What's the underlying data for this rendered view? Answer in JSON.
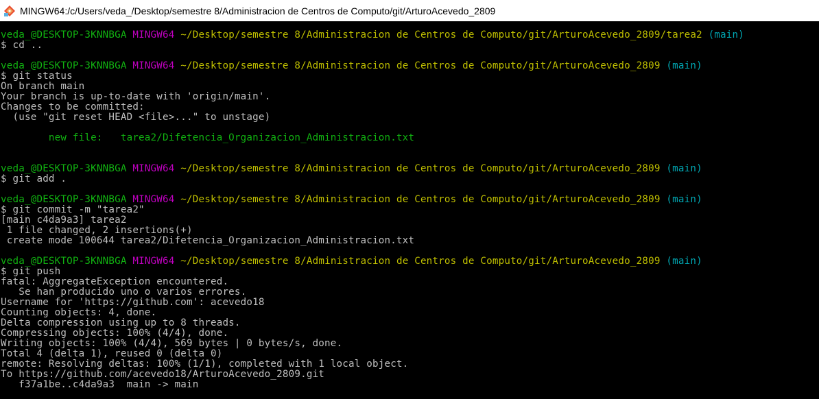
{
  "window": {
    "title": "MINGW64:/c/Users/veda_/Desktop/semestre 8/Administracion de Centros de Computo/git/ArturoAcevedo_2809",
    "icon": "git-bash-icon"
  },
  "colors": {
    "background": "#000000",
    "text": "#c0c0c0",
    "user_host": "#11b311",
    "shell": "#bf00bf",
    "path": "#bfbf00",
    "branch": "#00a6b2",
    "staged_file": "#11b311"
  },
  "lines": [
    {
      "segments": [
        {
          "text": "veda_@DESKTOP-3KNNBGA",
          "color": "green"
        },
        {
          "text": " ",
          "color": "gray"
        },
        {
          "text": "MINGW64",
          "color": "magenta"
        },
        {
          "text": " ",
          "color": "gray"
        },
        {
          "text": "~/Desktop/semestre 8/Administracion de Centros de Computo/git/ArturoAcevedo_2809/tarea2",
          "color": "yellow"
        },
        {
          "text": " ",
          "color": "gray"
        },
        {
          "text": "(main)",
          "color": "cyan"
        }
      ]
    },
    {
      "segments": [
        {
          "text": "$ cd ..",
          "color": "gray"
        }
      ]
    },
    {
      "segments": []
    },
    {
      "segments": [
        {
          "text": "veda_@DESKTOP-3KNNBGA",
          "color": "green"
        },
        {
          "text": " ",
          "color": "gray"
        },
        {
          "text": "MINGW64",
          "color": "magenta"
        },
        {
          "text": " ",
          "color": "gray"
        },
        {
          "text": "~/Desktop/semestre 8/Administracion de Centros de Computo/git/ArturoAcevedo_2809",
          "color": "yellow"
        },
        {
          "text": " ",
          "color": "gray"
        },
        {
          "text": "(main)",
          "color": "cyan"
        }
      ]
    },
    {
      "segments": [
        {
          "text": "$ git status",
          "color": "gray"
        }
      ]
    },
    {
      "segments": [
        {
          "text": "On branch main",
          "color": "gray"
        }
      ]
    },
    {
      "segments": [
        {
          "text": "Your branch is up-to-date with 'origin/main'.",
          "color": "gray"
        }
      ]
    },
    {
      "segments": [
        {
          "text": "Changes to be committed:",
          "color": "gray"
        }
      ]
    },
    {
      "segments": [
        {
          "text": "  (use \"git reset HEAD <file>...\" to unstage)",
          "color": "gray"
        }
      ]
    },
    {
      "segments": []
    },
    {
      "segments": [
        {
          "text": "        new file:   tarea2/Difetencia_Organizacion_Administracion.txt",
          "color": "green"
        }
      ]
    },
    {
      "segments": []
    },
    {
      "segments": []
    },
    {
      "segments": [
        {
          "text": "veda_@DESKTOP-3KNNBGA",
          "color": "green"
        },
        {
          "text": " ",
          "color": "gray"
        },
        {
          "text": "MINGW64",
          "color": "magenta"
        },
        {
          "text": " ",
          "color": "gray"
        },
        {
          "text": "~/Desktop/semestre 8/Administracion de Centros de Computo/git/ArturoAcevedo_2809",
          "color": "yellow"
        },
        {
          "text": " ",
          "color": "gray"
        },
        {
          "text": "(main)",
          "color": "cyan"
        }
      ]
    },
    {
      "segments": [
        {
          "text": "$ git add .",
          "color": "gray"
        }
      ]
    },
    {
      "segments": []
    },
    {
      "segments": [
        {
          "text": "veda_@DESKTOP-3KNNBGA",
          "color": "green"
        },
        {
          "text": " ",
          "color": "gray"
        },
        {
          "text": "MINGW64",
          "color": "magenta"
        },
        {
          "text": " ",
          "color": "gray"
        },
        {
          "text": "~/Desktop/semestre 8/Administracion de Centros de Computo/git/ArturoAcevedo_2809",
          "color": "yellow"
        },
        {
          "text": " ",
          "color": "gray"
        },
        {
          "text": "(main)",
          "color": "cyan"
        }
      ]
    },
    {
      "segments": [
        {
          "text": "$ git commit -m \"tarea2\"",
          "color": "gray"
        }
      ]
    },
    {
      "segments": [
        {
          "text": "[main c4da9a3] tarea2",
          "color": "gray"
        }
      ]
    },
    {
      "segments": [
        {
          "text": " 1 file changed, 2 insertions(+)",
          "color": "gray"
        }
      ]
    },
    {
      "segments": [
        {
          "text": " create mode 100644 tarea2/Difetencia_Organizacion_Administracion.txt",
          "color": "gray"
        }
      ]
    },
    {
      "segments": []
    },
    {
      "segments": [
        {
          "text": "veda_@DESKTOP-3KNNBGA",
          "color": "green"
        },
        {
          "text": " ",
          "color": "gray"
        },
        {
          "text": "MINGW64",
          "color": "magenta"
        },
        {
          "text": " ",
          "color": "gray"
        },
        {
          "text": "~/Desktop/semestre 8/Administracion de Centros de Computo/git/ArturoAcevedo_2809",
          "color": "yellow"
        },
        {
          "text": " ",
          "color": "gray"
        },
        {
          "text": "(main)",
          "color": "cyan"
        }
      ]
    },
    {
      "segments": [
        {
          "text": "$ git push",
          "color": "gray"
        }
      ]
    },
    {
      "segments": [
        {
          "text": "fatal: AggregateException encountered.",
          "color": "gray"
        }
      ]
    },
    {
      "segments": [
        {
          "text": "   Se han producido uno o varios errores.",
          "color": "gray"
        }
      ]
    },
    {
      "segments": [
        {
          "text": "Username for 'https://github.com': acevedo18",
          "color": "gray"
        }
      ]
    },
    {
      "segments": [
        {
          "text": "Counting objects: 4, done.",
          "color": "gray"
        }
      ]
    },
    {
      "segments": [
        {
          "text": "Delta compression using up to 8 threads.",
          "color": "gray"
        }
      ]
    },
    {
      "segments": [
        {
          "text": "Compressing objects: 100% (4/4), done.",
          "color": "gray"
        }
      ]
    },
    {
      "segments": [
        {
          "text": "Writing objects: 100% (4/4), 569 bytes | 0 bytes/s, done.",
          "color": "gray"
        }
      ]
    },
    {
      "segments": [
        {
          "text": "Total 4 (delta 1), reused 0 (delta 0)",
          "color": "gray"
        }
      ]
    },
    {
      "segments": [
        {
          "text": "remote: Resolving deltas: 100% (1/1), completed with 1 local object.",
          "color": "gray"
        }
      ]
    },
    {
      "segments": [
        {
          "text": "To https://github.com/acevedo18/ArturoAcevedo_2809.git",
          "color": "gray"
        }
      ]
    },
    {
      "segments": [
        {
          "text": "   f37a1be..c4da9a3  main -> main",
          "color": "gray"
        }
      ]
    }
  ]
}
